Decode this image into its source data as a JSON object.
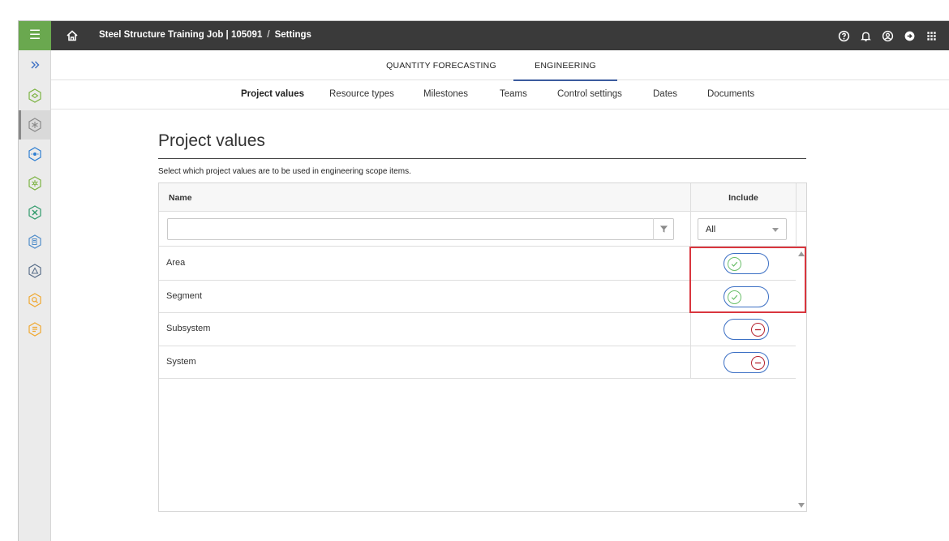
{
  "header": {
    "breadcrumb_job": "Steel Structure Training Job | 105091",
    "breadcrumb_sep": "/",
    "breadcrumb_page": "Settings",
    "icons": [
      "help-icon",
      "notification-bell-icon",
      "user-account-icon",
      "sign-out-icon",
      "app-launcher-icon"
    ]
  },
  "rail": {
    "expand_icon": "double-chevron-right-icon",
    "items": [
      {
        "icon": "project-hex-icon",
        "active": false
      },
      {
        "icon": "settings-hex-icon",
        "active": true
      },
      {
        "icon": "location-hex-icon",
        "active": false
      },
      {
        "icon": "network-hex-icon",
        "active": false
      },
      {
        "icon": "tools-hex-icon",
        "active": false
      },
      {
        "icon": "documents-hex-icon",
        "active": false
      },
      {
        "icon": "drafting-hex-icon",
        "active": false
      },
      {
        "icon": "search-hex-icon",
        "active": false
      },
      {
        "icon": "list-hex-icon",
        "active": false
      }
    ]
  },
  "module_tabs": [
    {
      "label": "QUANTITY FORECASTING",
      "active": false
    },
    {
      "label": "ENGINEERING",
      "active": true
    }
  ],
  "sub_tabs": [
    {
      "label": "Project values",
      "active": true
    },
    {
      "label": "Resource types",
      "active": false
    },
    {
      "label": "Milestones",
      "active": false
    },
    {
      "label": "Teams",
      "active": false
    },
    {
      "label": "Control settings",
      "active": false
    },
    {
      "label": "Dates",
      "active": false
    },
    {
      "label": "Documents",
      "active": false
    }
  ],
  "page": {
    "title": "Project values",
    "description": "Select which project values are to be used in engineering scope items."
  },
  "grid": {
    "columns": {
      "name": "Name",
      "include": "Include"
    },
    "filter": {
      "name_value": "",
      "include_value": "All"
    },
    "rows": [
      {
        "name": "Area",
        "include": true
      },
      {
        "name": "Segment",
        "include": true
      },
      {
        "name": "Subsystem",
        "include": false
      },
      {
        "name": "System",
        "include": false
      }
    ]
  },
  "colors": {
    "topbar": "#3a3a3a",
    "menu_accent": "#6aa84f",
    "tab_underline": "#3b5b9e",
    "toggle_border": "#3b6fc4",
    "included": "#6bbf6b",
    "excluded": "#b5232f",
    "highlight": "#d9363e"
  }
}
